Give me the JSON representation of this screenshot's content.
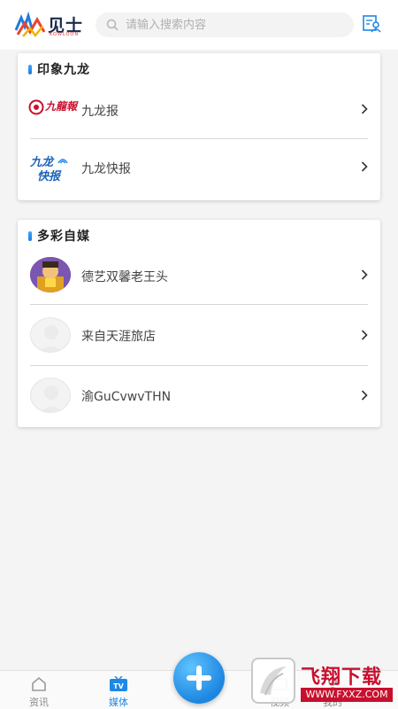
{
  "header": {
    "logo_text": "见士",
    "logo_sub": "KOWLOON",
    "search_placeholder": "请输入搜索内容"
  },
  "sections": [
    {
      "title": "印象九龙",
      "items": [
        {
          "label": "九龙报",
          "logo_text": "九龍報"
        },
        {
          "label": "九龙快报",
          "logo_text_top": "九龙",
          "logo_text_bottom": "快报"
        }
      ]
    },
    {
      "title": "多彩自媒",
      "items": [
        {
          "label": "德艺双馨老王头"
        },
        {
          "label": "来自天涯旅店"
        },
        {
          "label": "渝GuCvwvTHN"
        }
      ]
    }
  ],
  "bottom_nav": {
    "items": [
      {
        "label": "资讯",
        "active": false
      },
      {
        "label": "媒体",
        "active": true
      },
      {
        "label": "视频",
        "active": false
      },
      {
        "label": "我的",
        "active": false
      }
    ],
    "tv_badge": "TV"
  },
  "watermark": {
    "title": "飞翔下载",
    "url": "WWW.FXXZ.COM"
  },
  "colors": {
    "accent": "#1e88e5",
    "watermark_red": "#c8102e"
  }
}
